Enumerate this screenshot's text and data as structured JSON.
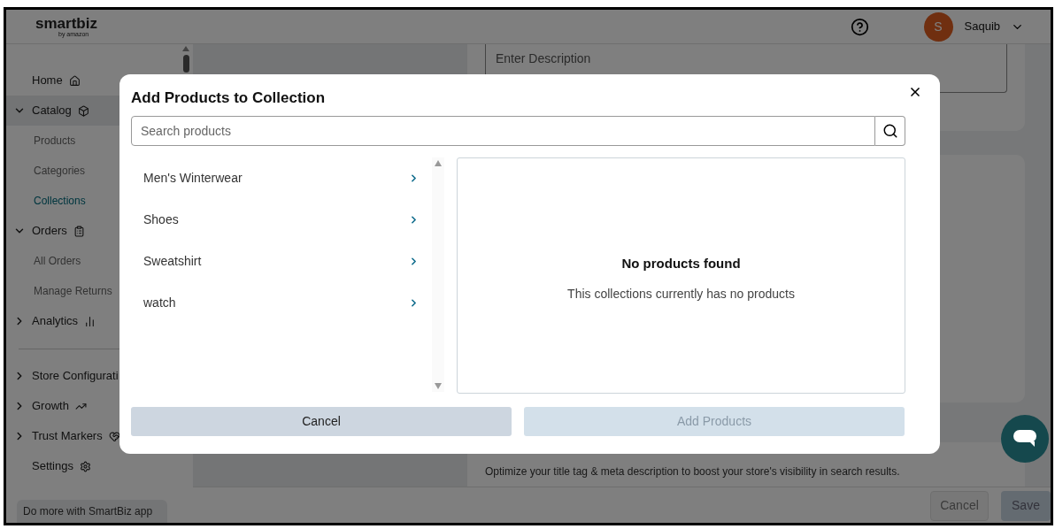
{
  "header": {
    "logo": "smartbiz",
    "logo_sub": "by amazon",
    "user": {
      "initial": "S",
      "name": "Saquib"
    }
  },
  "sidebar": {
    "sections": [
      {
        "items": [
          {
            "label": "Home",
            "selected": false
          },
          {
            "label": "Catalog",
            "selected": true,
            "expanded": true,
            "children": [
              {
                "label": "Products",
                "selected": false
              },
              {
                "label": "Categories",
                "selected": false
              },
              {
                "label": "Collections",
                "selected": true
              }
            ]
          },
          {
            "label": "Orders",
            "selected": false,
            "expanded": true,
            "children": [
              {
                "label": "All Orders",
                "selected": false
              },
              {
                "label": "Manage Returns",
                "selected": false
              }
            ]
          },
          {
            "label": "Analytics",
            "selected": false,
            "expanded": false
          }
        ]
      },
      {
        "items": [
          {
            "label": "Store Configurati",
            "selected": false,
            "expanded": false
          },
          {
            "label": "Growth",
            "selected": false,
            "expanded": false
          },
          {
            "label": "Trust Markers",
            "selected": false,
            "expanded": false
          },
          {
            "label": "Settings",
            "selected": false
          }
        ]
      }
    ],
    "promo": "Do more with SmartBiz app"
  },
  "main": {
    "description": {
      "placeholder": "Enter Description"
    },
    "seo_text": "Optimize your title tag & meta description to boost your store's visibility in search results.",
    "buttons": [
      "Cancel",
      "Save"
    ]
  },
  "modal": {
    "title": "Add Products to Collection",
    "search": {
      "placeholder": "Search products"
    },
    "categories": [
      {
        "label": "Men's Winterwear"
      },
      {
        "label": "Shoes"
      },
      {
        "label": "Sweatshirt"
      },
      {
        "label": "watch"
      }
    ],
    "empty": {
      "title": "No products found",
      "message": "This collections currently has no products"
    },
    "cancel": "Cancel",
    "submit": {
      "label": "Add Products",
      "disabled": true
    }
  }
}
